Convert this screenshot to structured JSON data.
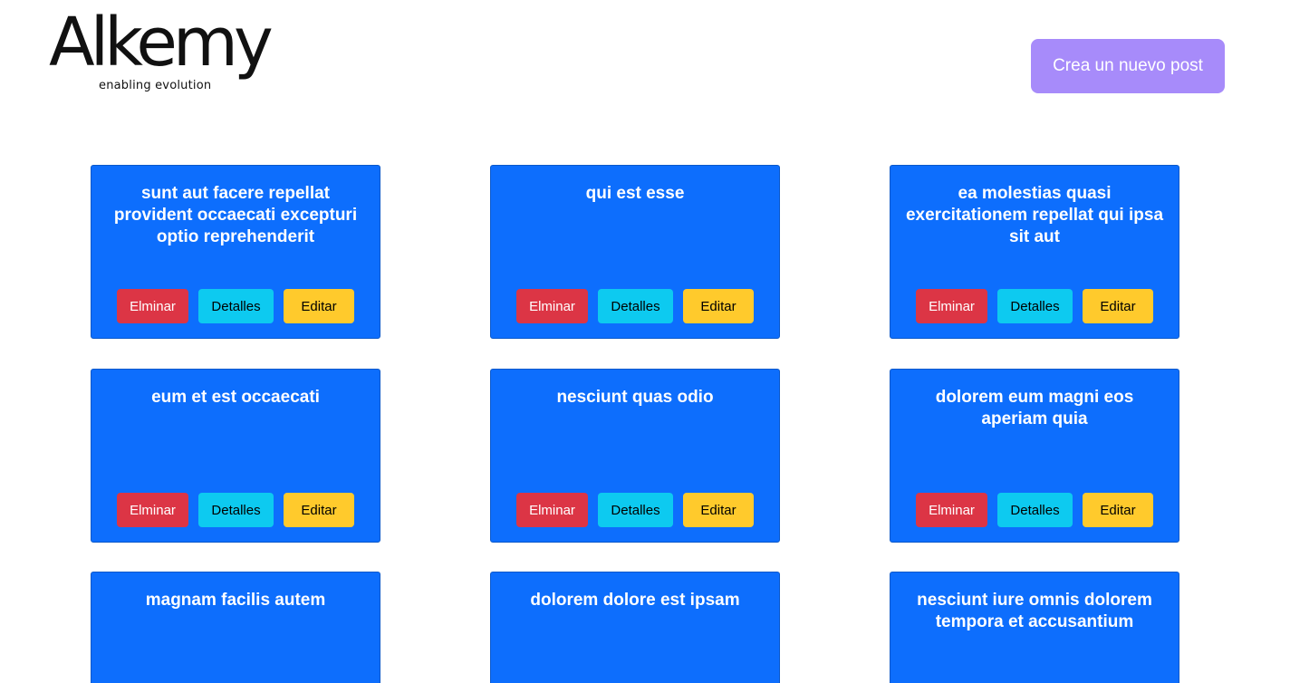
{
  "header": {
    "logo_word": "Alkemy",
    "logo_tagline": "enabling evolution",
    "new_post_label": "Crea un nuevo post"
  },
  "colors": {
    "card_bg": "#0d6efd",
    "delete_btn": "#dc3545",
    "details_btn": "#0dcaf0",
    "edit_btn": "#ffca2c",
    "new_post_btn": "#a78bfa"
  },
  "posts": [
    {
      "title": "sunt aut facere repellat provident occaecati excepturi optio reprehenderit",
      "delete_label": "Elminar",
      "details_label": "Detalles",
      "edit_label": "Editar"
    },
    {
      "title": "qui est esse",
      "delete_label": "Elminar",
      "details_label": "Detalles",
      "edit_label": "Editar"
    },
    {
      "title": "ea molestias quasi exercitationem repellat qui ipsa sit aut",
      "delete_label": "Elminar",
      "details_label": "Detalles",
      "edit_label": "Editar"
    },
    {
      "title": "eum et est occaecati",
      "delete_label": "Elminar",
      "details_label": "Detalles",
      "edit_label": "Editar"
    },
    {
      "title": "nesciunt quas odio",
      "delete_label": "Elminar",
      "details_label": "Detalles",
      "edit_label": "Editar"
    },
    {
      "title": "dolorem eum magni eos aperiam quia",
      "delete_label": "Elminar",
      "details_label": "Detalles",
      "edit_label": "Editar"
    },
    {
      "title": "magnam facilis autem"
    },
    {
      "title": "dolorem dolore est ipsam"
    },
    {
      "title": "nesciunt iure omnis dolorem tempora et accusantium"
    }
  ]
}
